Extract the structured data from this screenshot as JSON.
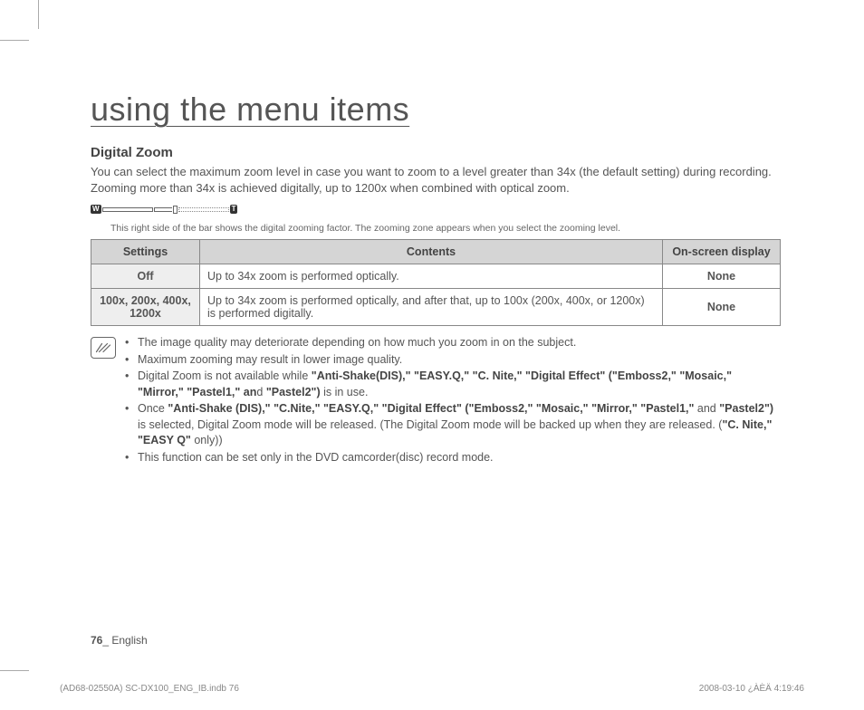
{
  "page_title": "using the menu items",
  "section": {
    "title": "Digital Zoom",
    "intro": "You can select the maximum zoom level in case you want to zoom to a level greater than 34x (the default setting) during recording. Zooming more than 34x is achieved digitally, up to 1200x when combined with optical zoom."
  },
  "zoom_bar": {
    "left_label": "W",
    "right_label": "T",
    "caption": "This right side of the bar shows the digital zooming factor. The zooming zone appears when you select the zooming level."
  },
  "table": {
    "headers": [
      "Settings",
      "Contents",
      "On-screen display"
    ],
    "rows": [
      {
        "setting": "Off",
        "contents": "Up to 34x zoom is performed optically.",
        "display": "None"
      },
      {
        "setting": "100x, 200x, 400x, 1200x",
        "contents": "Up to 34x zoom is performed optically, and after that, up to 100x (200x, 400x, or 1200x) is performed digitally.",
        "display": "None"
      }
    ]
  },
  "notes": {
    "n1": "The image quality may deteriorate depending on how much you zoom in on the subject.",
    "n2": "Maximum zooming may result in lower image quality.",
    "n3_pre": "Digital Zoom is not available while ",
    "n3_bold1": "\"Anti-Shake(DIS),\" \"EASY.Q,\" \"C. Nite,\" \"Digital Effect\" (\"Emboss2,\" \"Mosaic,\" \"Mirror,\" \"Pastel1,\" an",
    "n3_mid": "d ",
    "n3_bold2": "\"Pastel2\")",
    "n3_post": " is in use.",
    "n4_pre": "Once ",
    "n4_bold1": "\"Anti-Shake (DIS),\" \"C.Nite,\" \"EASY.Q,\" \"Digital Effect\" (\"Emboss2,\" \"Mosaic,\" \"Mirror,\" \"Pastel1,\"",
    "n4_mid1": " and ",
    "n4_bold2": "\"Pastel2\")",
    "n4_mid2": " is selected, Digital Zoom mode will be released. (The Digital Zoom mode will be backed up when they are released. (",
    "n4_bold3": "\"C. Nite,\" \"EASY Q\"",
    "n4_post": " only))",
    "n5": "This function can be set only in the DVD camcorder(disc) record mode."
  },
  "footer": {
    "page_num": "76",
    "page_lang": "_ English",
    "print_left": "(AD68-02550A) SC-DX100_ENG_IB.indb   76",
    "print_right": "2008-03-10   ¿ÀÈÄ 4:19:46"
  }
}
